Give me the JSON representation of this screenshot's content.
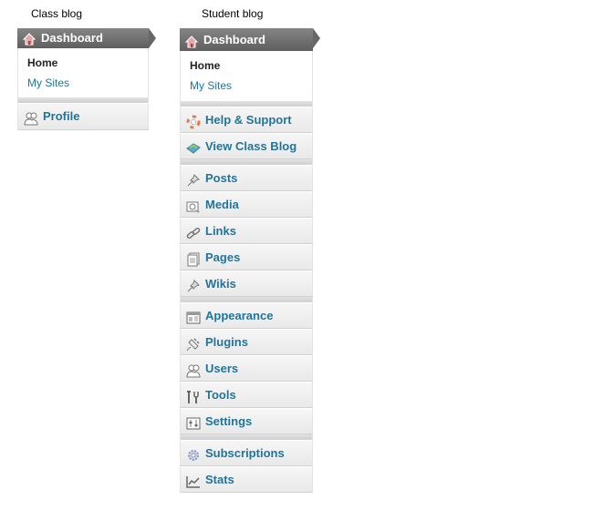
{
  "captions": {
    "class": "Class blog",
    "student": "Student blog"
  },
  "class_blog": {
    "dashboard": "Dashboard",
    "submenu": {
      "home": "Home",
      "my_sites": "My Sites"
    },
    "items": [
      {
        "label": "Profile",
        "icon": "users-icon"
      }
    ]
  },
  "student_blog": {
    "dashboard": "Dashboard",
    "submenu": {
      "home": "Home",
      "my_sites": "My Sites"
    },
    "groups": [
      [
        {
          "label": "Help & Support",
          "icon": "lifebuoy-icon"
        },
        {
          "label": "View Class Blog",
          "icon": "blog-icon"
        }
      ],
      [
        {
          "label": "Posts",
          "icon": "pushpin-icon"
        },
        {
          "label": "Media",
          "icon": "media-icon"
        },
        {
          "label": "Links",
          "icon": "link-icon"
        },
        {
          "label": "Pages",
          "icon": "pages-icon"
        },
        {
          "label": "Wikis",
          "icon": "pushpin-icon"
        }
      ],
      [
        {
          "label": "Appearance",
          "icon": "appearance-icon"
        },
        {
          "label": "Plugins",
          "icon": "plugin-icon"
        },
        {
          "label": "Users",
          "icon": "users-icon"
        },
        {
          "label": "Tools",
          "icon": "tools-icon"
        },
        {
          "label": "Settings",
          "icon": "settings-icon"
        }
      ],
      [
        {
          "label": "Subscriptions",
          "icon": "gear-icon"
        },
        {
          "label": "Stats",
          "icon": "stats-icon"
        }
      ]
    ]
  },
  "colors": {
    "link": "#21759b",
    "dashboard_bg": "#6d6d6d"
  }
}
